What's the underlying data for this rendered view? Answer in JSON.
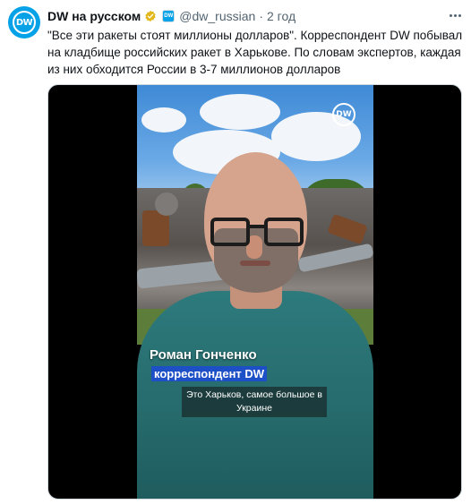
{
  "tweet": {
    "avatar_text": "DW",
    "display_name": "DW на русском",
    "handle": "@dw_russian",
    "separator": "·",
    "time": "2 год",
    "affiliate_badge": "DW",
    "text": "\"Все эти ракеты стоят миллионы долларов\". Корреспондент DW побывал на кладбище российских ракет в Харькове. По словам экспертов, каждая из них обходится России в 3-7 миллионов долларов"
  },
  "video": {
    "watermark": "DW",
    "lower_third_name": "Роман Гонченко",
    "lower_third_role": "корреспондент DW",
    "subtitle": "Это Харьков, самое большое в Украине"
  },
  "colors": {
    "brand": "#05a2e7",
    "verified": "#e2b719",
    "role_band": "#1d4fc7"
  }
}
